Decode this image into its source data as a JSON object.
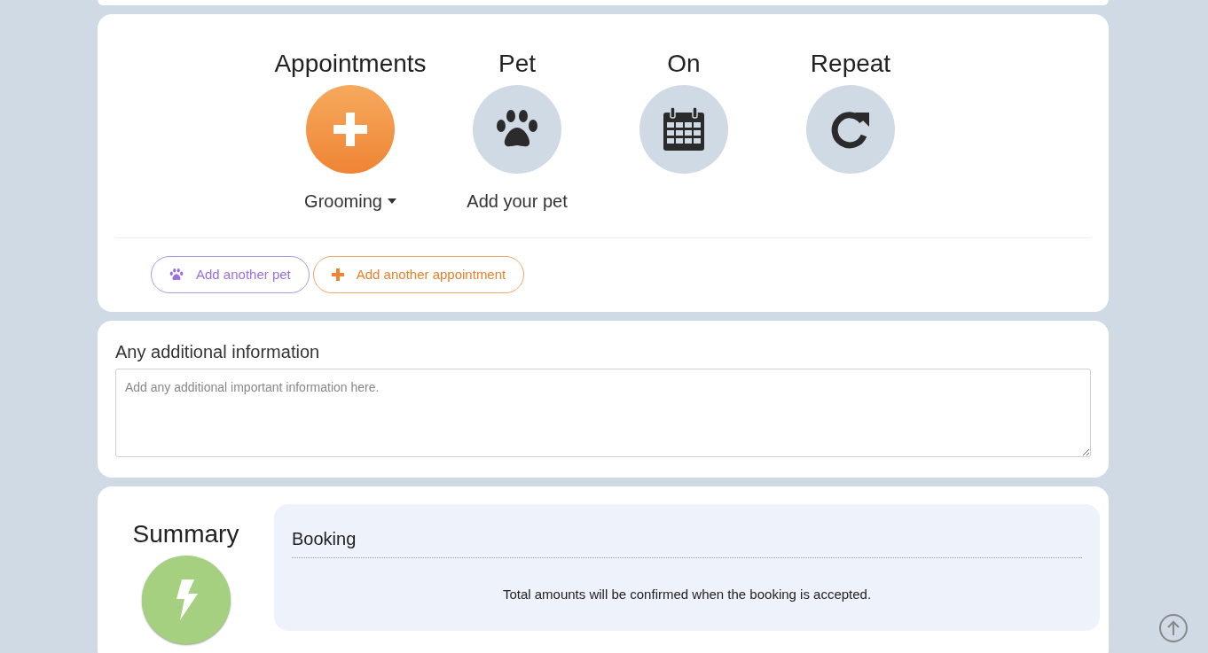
{
  "steps": [
    {
      "title": "Appointments",
      "kind": "add",
      "active": true,
      "subtitle": "Grooming",
      "dropdown": true
    },
    {
      "title": "Pet",
      "kind": "paw",
      "active": false,
      "subtitle": "Add your pet",
      "dropdown": false
    },
    {
      "title": "On",
      "kind": "calendar",
      "active": false
    },
    {
      "title": "Repeat",
      "kind": "repeat",
      "active": false
    }
  ],
  "actions": [
    {
      "kind": "pet",
      "label": "Add another pet"
    },
    {
      "kind": "appointment",
      "label": "Add another appointment"
    }
  ],
  "additional_info": {
    "label": "Any additional information",
    "placeholder": "Add any additional important information here."
  },
  "summary": {
    "title": "Summary",
    "panel_title": "Booking",
    "note": "Total amounts will be confirmed when the booking is accepted."
  }
}
